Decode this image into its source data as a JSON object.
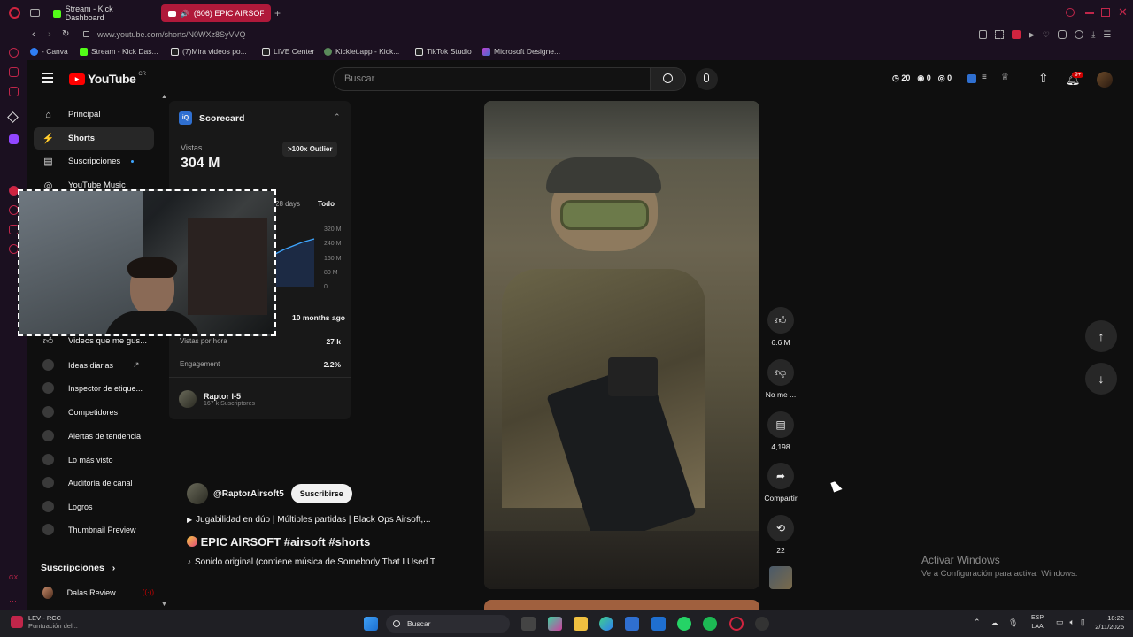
{
  "browser": {
    "tabs": [
      {
        "label": "Stream - Kick Dashboard"
      },
      {
        "label": "(606) EPIC AIRSOF"
      }
    ],
    "url": "www.youtube.com/shorts/N0WXz8SyVVQ",
    "bookmarks": [
      "- Canva",
      "Stream - Kick Das...",
      "(7)Mira videos po...",
      "LIVE Center",
      "Kicklet.app - Kick...",
      "TikTok Studio",
      "Microsoft Designe..."
    ]
  },
  "youtube": {
    "logo_text": "YouTube",
    "country_code": "CR",
    "search_placeholder": "Buscar",
    "stats": {
      "a": "20",
      "b": "0",
      "c": "0"
    },
    "notifications_badge": "9+",
    "sidebar": {
      "items": [
        "Principal",
        "Shorts",
        "Suscripciones",
        "YouTube Music"
      ],
      "liked": "Videos que me gus...",
      "ext_items": [
        "Ideas diarias",
        "Inspector de etique...",
        "Competidores",
        "Alertas de tendencia",
        "Lo más visto",
        "Auditoría de canal",
        "Logros",
        "Thumbnail Preview"
      ],
      "subs_heading": "Suscripciones",
      "subs": [
        "Dalas Review"
      ]
    },
    "scorecard": {
      "title": "Scorecard",
      "views_label": "Vistas",
      "views_value": "304 M",
      "outlier": ">100x Outlier",
      "range_28": "28 days",
      "range_all": "Todo",
      "axis": [
        "320 M",
        "240 M",
        "160 M",
        "80 M",
        "0"
      ],
      "age": "10 months ago",
      "rows": [
        {
          "label": "Vistas por hora",
          "value": "27 k"
        },
        {
          "label": "Engagement",
          "value": "2.2%"
        }
      ],
      "channel_name": "Raptor I-5",
      "channel_subs": "167 k Suscriptores"
    },
    "video": {
      "channel": "@RaptorAirsoft5",
      "subscribe": "Suscribirse",
      "playlist": "Jugabilidad en dúo | Múltiples partidas | Black Ops Airsoft,...",
      "title": "EPIC AIRSOFT #airsoft #shorts",
      "sound": "Sonido original (contiene música de Somebody That I Used T"
    },
    "actions": {
      "likes": "6.6 M",
      "dislike": "No me ...",
      "comments": "4,198",
      "share": "Compartir",
      "remix": "22"
    }
  },
  "watermark": {
    "line1": "Activar Windows",
    "line2": "Ve a Configuración para activar Windows."
  },
  "taskbar": {
    "widget_title": "LEV - RCC",
    "widget_sub": "Puntuación del...",
    "search": "Buscar",
    "lang1": "ESP",
    "lang2": "LAA",
    "time": "18:22",
    "date": "2/11/2025"
  }
}
